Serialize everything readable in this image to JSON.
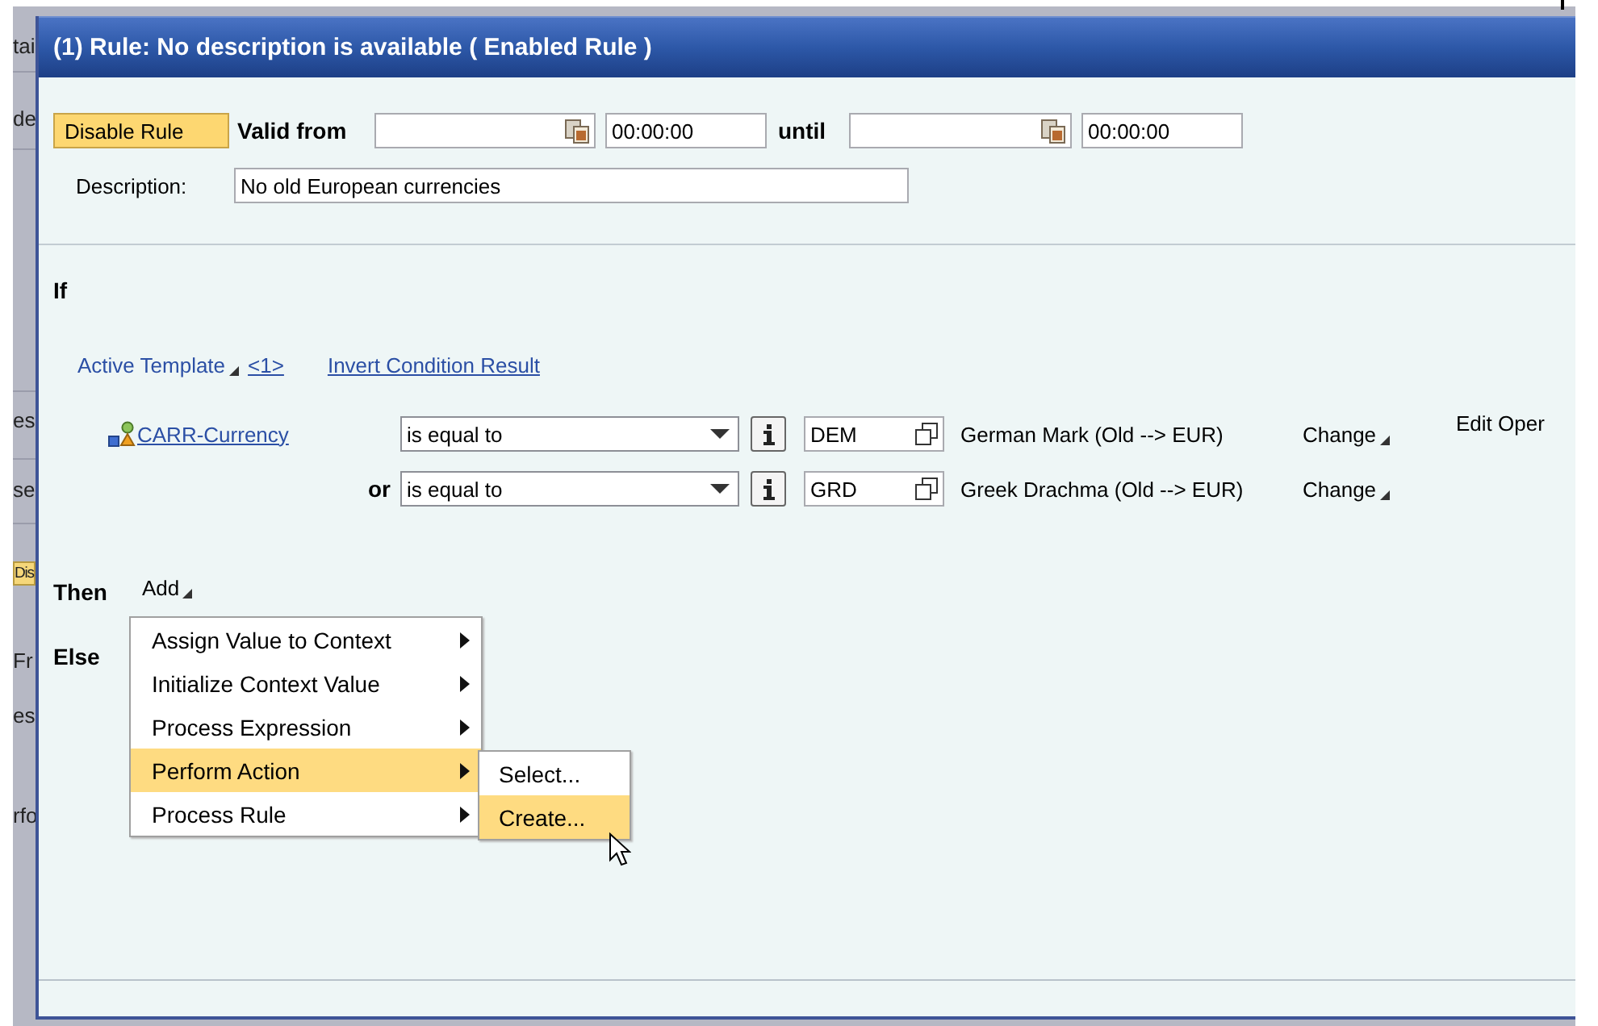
{
  "background_window": {
    "fragments": [
      {
        "text": "tai",
        "kind": "text"
      },
      {
        "text": "de",
        "kind": "text"
      },
      {
        "text": "es",
        "kind": "text"
      },
      {
        "text": "se",
        "kind": "text"
      },
      {
        "text": "Dis",
        "kind": "button"
      },
      {
        "text": "Fr",
        "kind": "text"
      },
      {
        "text": "es",
        "kind": "text"
      },
      {
        "text": "rfo",
        "kind": "text"
      }
    ]
  },
  "dialog": {
    "title": "(1) Rule: No description is available ( Enabled Rule )",
    "toggle_button": "Disable Rule",
    "valid_from_label": "Valid from",
    "valid_from_time": "00:00:00",
    "until_label": "until",
    "until_time": "00:00:00",
    "description": {
      "label": "Description:",
      "value": "No old European currencies"
    },
    "if_label": "If",
    "condition_links": [
      {
        "label": "Active Template",
        "kind": "menu"
      },
      {
        "label": "<1>",
        "kind": "link"
      },
      {
        "label": "Invert Condition Result",
        "kind": "link"
      }
    ],
    "conditions": [
      {
        "lead": {
          "kind": "field",
          "text": "CARR-Currency"
        },
        "operator": "is equal to",
        "value": "DEM",
        "value_text": "German Mark (Old --> EUR)",
        "action": "Change",
        "extra": "Edit Oper"
      },
      {
        "lead": {
          "kind": "connector",
          "text": "or"
        },
        "operator": "is equal to",
        "value": "GRD",
        "value_text": "Greek Drachma (Old --> EUR)",
        "action": "Change"
      }
    ],
    "then_label": "Then",
    "add_menu": "Add",
    "else_label": "Else"
  },
  "context_menu": {
    "items": [
      {
        "label": "Assign Value to Context",
        "selected": false
      },
      {
        "label": "Initialize Context Value",
        "selected": false
      },
      {
        "label": "Process Expression",
        "selected": false
      },
      {
        "label": "Perform Action",
        "selected": true
      },
      {
        "label": "Process Rule",
        "selected": false
      }
    ]
  },
  "submenu": {
    "items": [
      {
        "label": "Select...",
        "selected": false
      },
      {
        "label": "Create...",
        "selected": true
      }
    ]
  }
}
